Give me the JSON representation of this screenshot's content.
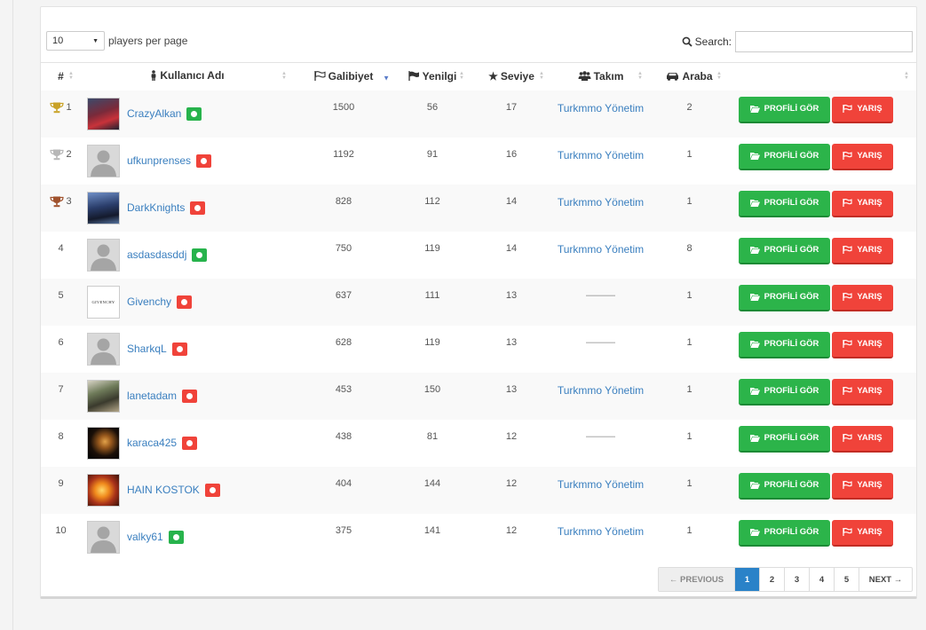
{
  "length_control": {
    "value": "10",
    "label": "players per page"
  },
  "search": {
    "label": "Search:",
    "placeholder": ""
  },
  "columns": [
    "#",
    "Kullanıcı Adı",
    "Galibiyet",
    "Yenilgi",
    "Seviye",
    "Takım",
    "Araba",
    ""
  ],
  "rows": [
    {
      "rank": "1",
      "trophy": "gold",
      "name": "CrazyAlkan",
      "status": "online",
      "avatar": "photo-red",
      "wins": "1500",
      "losses": "56",
      "level": "17",
      "team": "Turkmmo Yönetim",
      "cars": "2"
    },
    {
      "rank": "2",
      "trophy": "silver",
      "name": "ufkunprenses",
      "status": "offline",
      "avatar": "default",
      "wins": "1192",
      "losses": "91",
      "level": "16",
      "team": "Turkmmo Yönetim",
      "cars": "1"
    },
    {
      "rank": "3",
      "trophy": "bronze",
      "name": "DarkKnights",
      "status": "offline",
      "avatar": "photo-blue",
      "wins": "828",
      "losses": "112",
      "level": "14",
      "team": "Turkmmo Yönetim",
      "cars": "1"
    },
    {
      "rank": "4",
      "trophy": "",
      "name": "asdasdasddj",
      "status": "online",
      "avatar": "default",
      "wins": "750",
      "losses": "119",
      "level": "14",
      "team": "Turkmmo Yönetim",
      "cars": "8"
    },
    {
      "rank": "5",
      "trophy": "",
      "name": "Givenchy",
      "status": "offline",
      "avatar": "givenchy",
      "wins": "637",
      "losses": "111",
      "level": "13",
      "team": "———",
      "cars": "1"
    },
    {
      "rank": "6",
      "trophy": "",
      "name": "SharkqL",
      "status": "offline",
      "avatar": "default",
      "wins": "628",
      "losses": "119",
      "level": "13",
      "team": "———",
      "cars": "1"
    },
    {
      "rank": "7",
      "trophy": "",
      "name": "lanetadam",
      "status": "offline",
      "avatar": "photo-green",
      "wins": "453",
      "losses": "150",
      "level": "13",
      "team": "Turkmmo Yönetim",
      "cars": "1"
    },
    {
      "rank": "8",
      "trophy": "",
      "name": "karaca425",
      "status": "offline",
      "avatar": "photo-dark",
      "wins": "438",
      "losses": "81",
      "level": "12",
      "team": "———",
      "cars": "1"
    },
    {
      "rank": "9",
      "trophy": "",
      "name": "HAIN KOSTOK",
      "status": "offline",
      "avatar": "photo-fire",
      "wins": "404",
      "losses": "144",
      "level": "12",
      "team": "Turkmmo Yönetim",
      "cars": "1"
    },
    {
      "rank": "10",
      "trophy": "",
      "name": "valky61",
      "status": "online",
      "avatar": "default",
      "wins": "375",
      "losses": "141",
      "level": "12",
      "team": "Turkmmo Yönetim",
      "cars": "1"
    }
  ],
  "buttons": {
    "profile": "PROFİLİ GÖR",
    "race": "YARIŞ"
  },
  "avatar_text": {
    "givenchy": "GIVENCHY"
  },
  "pagination": {
    "previous": "← PREVIOUS",
    "pages": [
      "1",
      "2",
      "3",
      "4",
      "5"
    ],
    "active": "1",
    "next": "NEXT →"
  },
  "colors": {
    "online": "#27b34c",
    "offline": "#f0433a",
    "link": "#3a7fbf",
    "profile_btn": "#2cb44a",
    "race_btn": "#f0433a",
    "active_page": "#2a82c8",
    "gold": "#c9a227",
    "silver": "#b7b7b7",
    "bronze": "#a0522d"
  },
  "icons": {
    "search": "search-icon",
    "user_col": "user-icon",
    "wins_col": "flag-outline-icon",
    "losses_col": "flag-icon",
    "level_col": "star-icon",
    "team_col": "users-icon",
    "car_col": "car-icon",
    "trophy": "trophy-icon",
    "profile_btn": "folder-open-icon",
    "race_btn": "flag-outline-icon"
  }
}
